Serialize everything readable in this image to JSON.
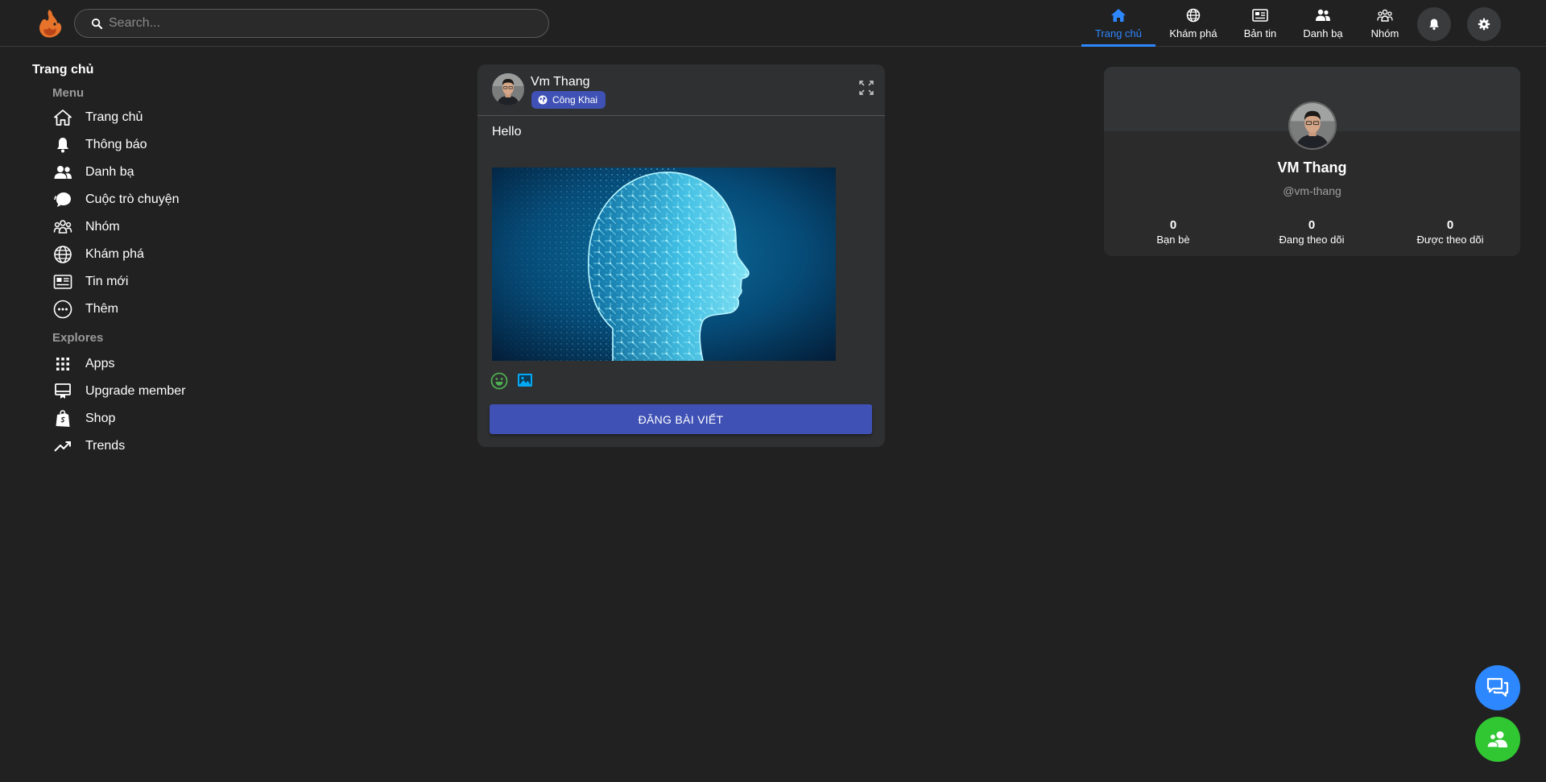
{
  "header": {
    "search_placeholder": "Search...",
    "nav": [
      {
        "label": "Trang chủ",
        "icon": "home-icon",
        "active": true
      },
      {
        "label": "Khám phá",
        "icon": "globe-icon",
        "active": false
      },
      {
        "label": "Bản tin",
        "icon": "newspaper-icon",
        "active": false
      },
      {
        "label": "Danh bạ",
        "icon": "contacts-icon",
        "active": false
      },
      {
        "label": "Nhóm",
        "icon": "group-icon",
        "active": false
      }
    ],
    "notification_icon": "bell-icon",
    "settings_icon": "gear-icon"
  },
  "sidebar": {
    "title": "Trang chủ",
    "menu_heading": "Menu",
    "menu": [
      {
        "label": "Trang chủ",
        "icon": "home-icon"
      },
      {
        "label": "Thông báo",
        "icon": "bell-icon"
      },
      {
        "label": "Danh bạ",
        "icon": "contacts-icon"
      },
      {
        "label": "Cuộc trò chuyện",
        "icon": "chat-icon"
      },
      {
        "label": "Nhóm",
        "icon": "group-icon"
      },
      {
        "label": "Khám phá",
        "icon": "globe-icon"
      },
      {
        "label": "Tin mới",
        "icon": "newspaper-icon"
      },
      {
        "label": "Thêm",
        "icon": "more-icon"
      }
    ],
    "explores_heading": "Explores",
    "explores": [
      {
        "label": "Apps",
        "icon": "apps-grid-icon"
      },
      {
        "label": "Upgrade member",
        "icon": "upgrade-icon"
      },
      {
        "label": "Shop",
        "icon": "shopify-bag-icon"
      },
      {
        "label": "Trends",
        "icon": "trending-icon"
      }
    ]
  },
  "post": {
    "author": "Vm Thang",
    "privacy": "Công Khai",
    "content": "Hello",
    "submit_label": "ĐĂNG BÀI VIẾT"
  },
  "profile": {
    "name": "VM Thang",
    "handle": "@vm-thang",
    "stats": [
      {
        "value": "0",
        "label": "Bạn bè"
      },
      {
        "value": "0",
        "label": "Đang theo dõi"
      },
      {
        "value": "0",
        "label": "Được theo dõi"
      }
    ]
  },
  "colors": {
    "accent": "#2d88ff",
    "button": "#3f51b5",
    "background": "#212121",
    "card": "#2f3031",
    "chat_fab": "#2d88ff",
    "contacts_fab": "#31c733"
  }
}
